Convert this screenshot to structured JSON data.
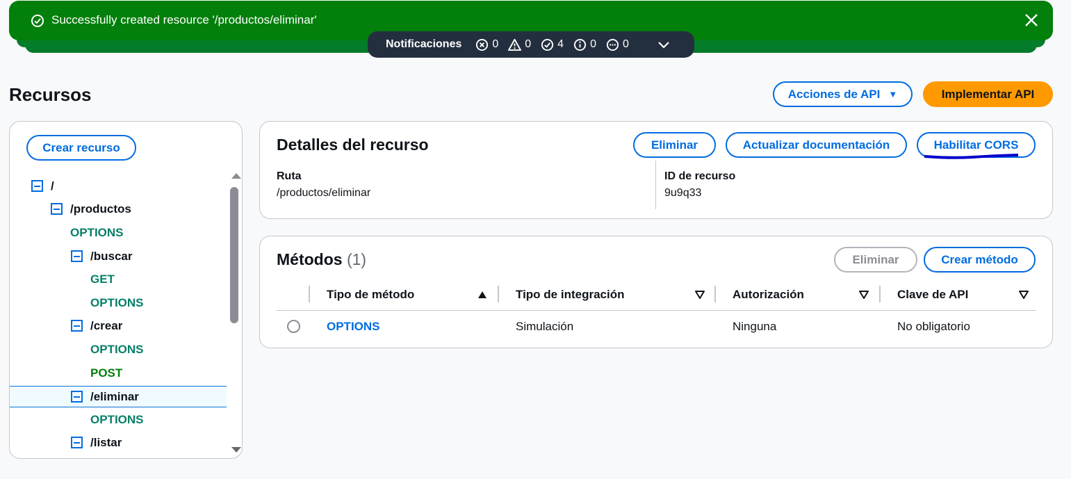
{
  "flash": {
    "message": "Successfully created resource '/productos/eliminar'",
    "status_color": "#037f0c"
  },
  "notifications": {
    "title": "Notificaciones",
    "errors": "0",
    "warnings": "0",
    "success": "4",
    "info": "0",
    "in_progress": "0"
  },
  "header": {
    "title": "Recursos",
    "api_actions_label": "Acciones de API",
    "deploy_label": "Implementar API"
  },
  "tree": {
    "create_label": "Crear recurso",
    "items": [
      {
        "label": "/",
        "kind": "resource"
      },
      {
        "label": "/productos",
        "kind": "resource"
      },
      {
        "label": "OPTIONS",
        "kind": "method"
      },
      {
        "label": "/buscar",
        "kind": "resource"
      },
      {
        "label": "GET",
        "kind": "method"
      },
      {
        "label": "OPTIONS",
        "kind": "method"
      },
      {
        "label": "/crear",
        "kind": "resource"
      },
      {
        "label": "OPTIONS",
        "kind": "method"
      },
      {
        "label": "POST",
        "kind": "method"
      },
      {
        "label": "/eliminar",
        "kind": "resource",
        "selected": true
      },
      {
        "label": "OPTIONS",
        "kind": "method"
      },
      {
        "label": "/listar",
        "kind": "resource"
      }
    ]
  },
  "details": {
    "title": "Detalles del recurso",
    "delete_label": "Eliminar",
    "update_docs_label": "Actualizar documentación",
    "enable_cors_label": "Habilitar CORS",
    "path_label": "Ruta",
    "path_value": "/productos/eliminar",
    "id_label": "ID de recurso",
    "id_value": "9u9q33"
  },
  "methods": {
    "title": "Métodos",
    "count": "(1)",
    "delete_label": "Eliminar",
    "create_label": "Crear método",
    "columns": [
      "Tipo de método",
      "Tipo de integración",
      "Autorización",
      "Clave de API"
    ],
    "rows": [
      {
        "method": "OPTIONS",
        "integration": "Simulación",
        "auth": "Ninguna",
        "api_key": "No obligatorio"
      }
    ]
  },
  "colors": {
    "accent": "#006ce0",
    "primary_button": "#ff9900",
    "annotation": "#0000cc"
  }
}
